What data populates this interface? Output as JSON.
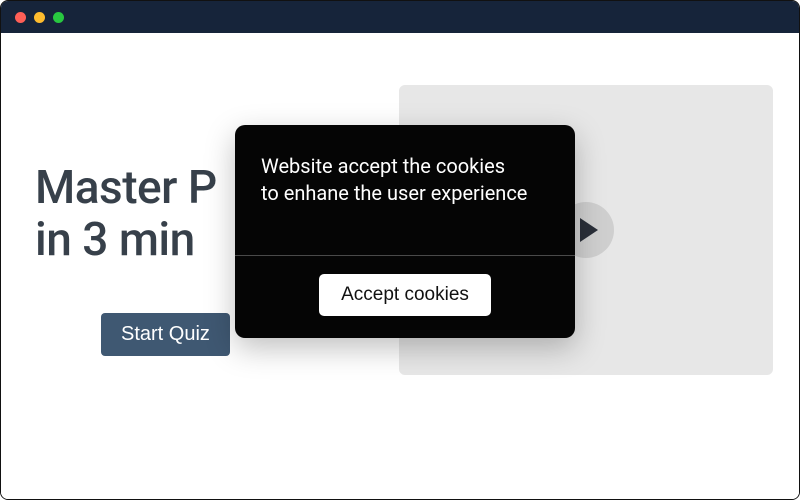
{
  "hero": {
    "title_line1": "Master P",
    "title_line2": "in 3 min",
    "start_label": "Start Quiz"
  },
  "video": {
    "play_icon": "play-icon"
  },
  "cookie_modal": {
    "message": "Website accept the cookies\nto enhane the user experience",
    "accept_label": "Accept cookies"
  },
  "colors": {
    "titlebar": "#16243a",
    "modal_bg": "#050505",
    "start_btn": "#3f5872",
    "video_thumb": "#e7e7e7"
  }
}
